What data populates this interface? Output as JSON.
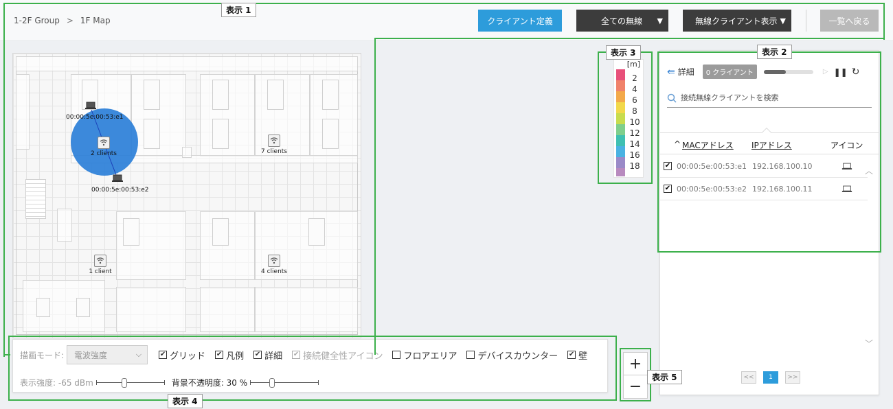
{
  "header": {
    "breadcrumb": [
      "1-2F Group",
      ">",
      "1F Map"
    ],
    "define_client_button": "クライアント定義",
    "wireless_filter": "全ての無線",
    "client_display": "無線クライアント表示",
    "back_button": "一覧へ戻る",
    "caret": "▼"
  },
  "colors": {
    "primary": "#2d9cdb",
    "dark_button": "#3c3c3c",
    "annotation": "#3cb04b",
    "coverage": "#2b7fd8"
  },
  "map": {
    "access_points": [
      {
        "label": "2 clients",
        "icon": "wifi-icon"
      },
      {
        "label": "7 clients",
        "icon": "wifi-icon"
      },
      {
        "label": "1 client",
        "icon": "wifi-icon"
      },
      {
        "label": "4 clients",
        "icon": "wifi-icon"
      }
    ],
    "clients": [
      {
        "mac": "00:00:5e:00:53:e1",
        "icon": "laptop-icon"
      },
      {
        "mac": "00:00:5e:00:53:e2",
        "icon": "laptop-icon"
      }
    ]
  },
  "legend": {
    "unit": "[m]",
    "items": [
      {
        "label": "2",
        "color": "#e8507a"
      },
      {
        "label": "4",
        "color": "#f0826a"
      },
      {
        "label": "6",
        "color": "#f3a94a"
      },
      {
        "label": "8",
        "color": "#f2d84a"
      },
      {
        "label": "10",
        "color": "#c8dc4e"
      },
      {
        "label": "12",
        "color": "#7fcf8c"
      },
      {
        "label": "14",
        "color": "#3fc0b2"
      },
      {
        "label": "16",
        "color": "#4ab2e2"
      },
      {
        "label": "18",
        "color": "#9a8ac8"
      },
      {
        "label": "",
        "color": "#b88abf"
      }
    ]
  },
  "panel": {
    "detail_label": "詳細",
    "client_count": "0 クライアント",
    "progress": 0.45,
    "search_placeholder": "接続無線クライアントを検索",
    "columns": {
      "sort": "^",
      "mac": "MACアドレス",
      "ip": "IPアドレス",
      "icon": "アイコン"
    },
    "rows": [
      {
        "checked": true,
        "mac": "00:00:5e:00:53:e1",
        "ip": "192.168.100.10"
      },
      {
        "checked": true,
        "mac": "00:00:5e:00:53:e2",
        "ip": "192.168.100.11"
      }
    ],
    "pager": {
      "first": "<<",
      "current": "1",
      "next": ">>"
    }
  },
  "controls": {
    "mode_label": "描画モード:",
    "mode_value": "電波強度",
    "checkboxes": [
      {
        "label": "グリッド",
        "checked": true,
        "disabled": false
      },
      {
        "label": "凡例",
        "checked": true,
        "disabled": false
      },
      {
        "label": "詳細",
        "checked": true,
        "disabled": false
      },
      {
        "label": "接続健全性アイコン",
        "checked": true,
        "disabled": true
      },
      {
        "label": "フロアエリア",
        "checked": false,
        "disabled": false
      },
      {
        "label": "デバイスカウンター",
        "checked": false,
        "disabled": false
      },
      {
        "label": "壁",
        "checked": true,
        "disabled": false
      }
    ],
    "strength_label": "表示強度: -65 dBm",
    "strength_value": 0.4,
    "opacity_label": "背景不透明度: 30 %",
    "opacity_value": 0.3
  },
  "zoom": {
    "plus": "+",
    "minus": "−"
  },
  "annotations": [
    "表示 1",
    "表示 2",
    "表示 3",
    "表示 4",
    "表示 5"
  ]
}
